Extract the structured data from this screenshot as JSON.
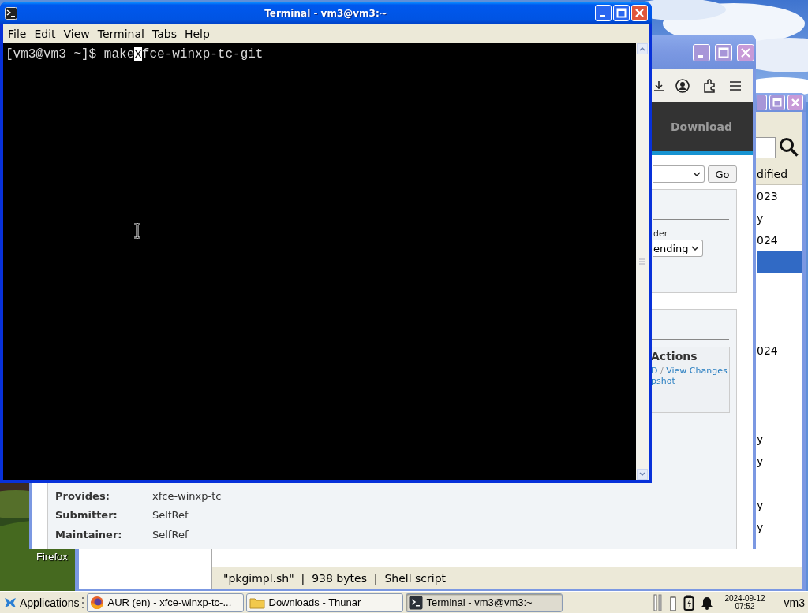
{
  "desktop": {
    "icon_label": "Firefox"
  },
  "firefox_window": {
    "active": false,
    "nav_item": "Download",
    "filter_button": "Go",
    "sort_label": "der",
    "sort_select": "ending",
    "actions": {
      "title": "Actions",
      "links": [
        "D",
        "View Changes"
      ],
      "separator": "/",
      "snapshot_link": "pshot"
    },
    "details": [
      {
        "label": "Provides:",
        "value": "xfce-winxp-tc"
      },
      {
        "label": "Submitter:",
        "value": "SelfRef"
      },
      {
        "label": "Maintainer:",
        "value": "SelfRef"
      }
    ]
  },
  "thunar_window": {
    "active": false,
    "column_header": "dified",
    "rows": [
      {
        "text": "023",
        "selected": false
      },
      {
        "text": "y",
        "selected": false
      },
      {
        "text": "024",
        "selected": false
      },
      {
        "selected": true
      },
      {
        "selected": false
      },
      {
        "selected": false
      },
      {
        "selected": false
      },
      {
        "text": "024",
        "selected": false
      },
      {
        "selected": false
      },
      {
        "selected": false
      },
      {
        "selected": false
      },
      {
        "text": "y",
        "selected": false
      },
      {
        "text": "y",
        "selected": false
      },
      {
        "selected": false
      },
      {
        "text": "y",
        "selected": false
      },
      {
        "text": "y",
        "selected": false
      }
    ],
    "status_bar": "\"pkgimpl.sh\"  |  938 bytes  |  Shell script"
  },
  "terminal_window": {
    "active": true,
    "title": "Terminal - vm3@vm3:~",
    "menu": [
      "File",
      "Edit",
      "View",
      "Terminal",
      "Tabs",
      "Help"
    ],
    "line": {
      "before_cursor": "[vm3@vm3 ~]$ make",
      "cursor_char": "x",
      "after_cursor": "fce-winxp-tc-git"
    }
  },
  "taskbar": {
    "menu_button": "Applications",
    "tasks": [
      {
        "kind": "browser",
        "label": "AUR (en) - xfce-winxp-tc-...",
        "selected": false
      },
      {
        "kind": "folder",
        "label": "Downloads - Thunar",
        "selected": false
      },
      {
        "kind": "terminal",
        "label": "Terminal - vm3@vm3:~",
        "selected": true
      }
    ],
    "clock": {
      "date": "2024-09-12",
      "time": "07:52"
    },
    "user": "vm3"
  }
}
